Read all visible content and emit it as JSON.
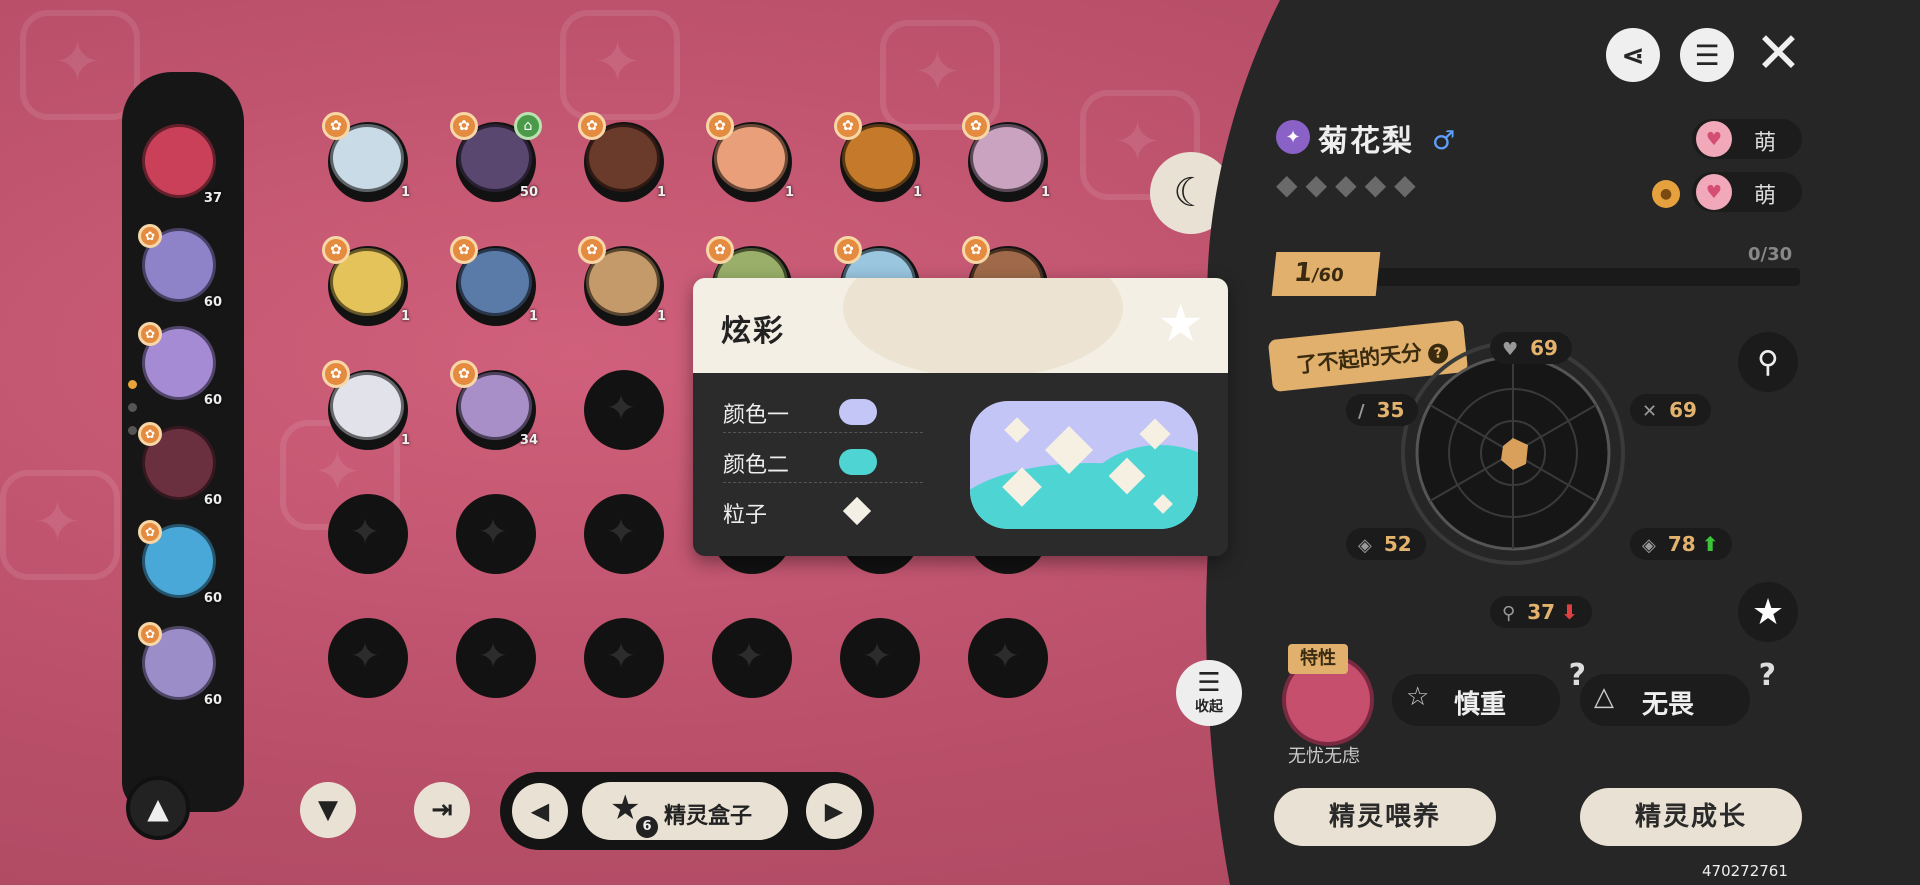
{
  "header": {
    "share_icon": "share-icon",
    "list_icon": "list-icon",
    "close_icon": "close-icon"
  },
  "pet": {
    "name": "菊花梨",
    "gender_symbol": "♂",
    "stars_display": "◆◆◆◆◆",
    "trait_pills": [
      "萌",
      "萌"
    ],
    "level_current": "1",
    "level_max": "/60",
    "xp_text": "0/30"
  },
  "talent": {
    "label": "了不起的天分",
    "help": "?"
  },
  "stats": {
    "top": "69",
    "upper_left": "35",
    "upper_right": "69",
    "lower_left": "52",
    "lower_right": "78",
    "bottom": "37",
    "lower_right_trend": "up",
    "bottom_trend": "down"
  },
  "feature": {
    "tag": "特性",
    "name": "无忧无虑"
  },
  "natures": [
    {
      "label": "慎重",
      "help": "?"
    },
    {
      "label": "无畏",
      "help": "?"
    }
  ],
  "actions": {
    "feed": "精灵喂养",
    "grow": "精灵成长",
    "collapse": "收起"
  },
  "uid": "470272761",
  "popup": {
    "title": "炫彩",
    "rows": [
      {
        "label": "颜色一",
        "color": "#c3c6f7",
        "kind": "swatch"
      },
      {
        "label": "颜色二",
        "color": "#4fd4d4",
        "kind": "swatch"
      },
      {
        "label": "粒子",
        "color": "#f4efe4",
        "kind": "diamond"
      }
    ]
  },
  "roster": {
    "levels": [
      "37",
      "60",
      "60",
      "60",
      "60",
      "60"
    ],
    "colors": [
      "#c94058",
      "#8e83c9",
      "#a58bd4",
      "#6b3040",
      "#4aa8d8",
      "#9a8dc8"
    ]
  },
  "grid": {
    "pets": [
      {
        "level": "1",
        "color": "#c9dbe6"
      },
      {
        "level": "50",
        "color": "#5a4770"
      },
      {
        "level": "1",
        "color": "#6a3a2a"
      },
      {
        "level": "1",
        "color": "#e9a07a"
      },
      {
        "level": "1",
        "color": "#c47a2a"
      },
      {
        "level": "1",
        "color": "#c9a3c0"
      },
      {
        "level": "1",
        "color": "#e3c35a"
      },
      {
        "level": "1",
        "color": "#5a7aa8"
      },
      {
        "level": "1",
        "color": "#c49a6a"
      },
      {
        "level": "",
        "color": "#9ab06a"
      },
      {
        "level": "",
        "color": "#9ac6e0"
      },
      {
        "level": "",
        "color": "#a06a4a"
      },
      {
        "level": "1",
        "color": "#e2e2ea"
      },
      {
        "level": "34",
        "color": "#a88fc8"
      }
    ]
  },
  "bottom_bar": {
    "box_label": "精灵盒子",
    "box_count": "6",
    "filter_icon": "filter-icon",
    "exit_icon": "exit-icon",
    "prev_icon": "prev-arrow-icon",
    "next_icon": "next-arrow-icon"
  },
  "colors": {
    "background": "#c2566e",
    "panel": "#262626",
    "accent_gold": "#e0b06c",
    "stat_text": "#e3b36e"
  }
}
